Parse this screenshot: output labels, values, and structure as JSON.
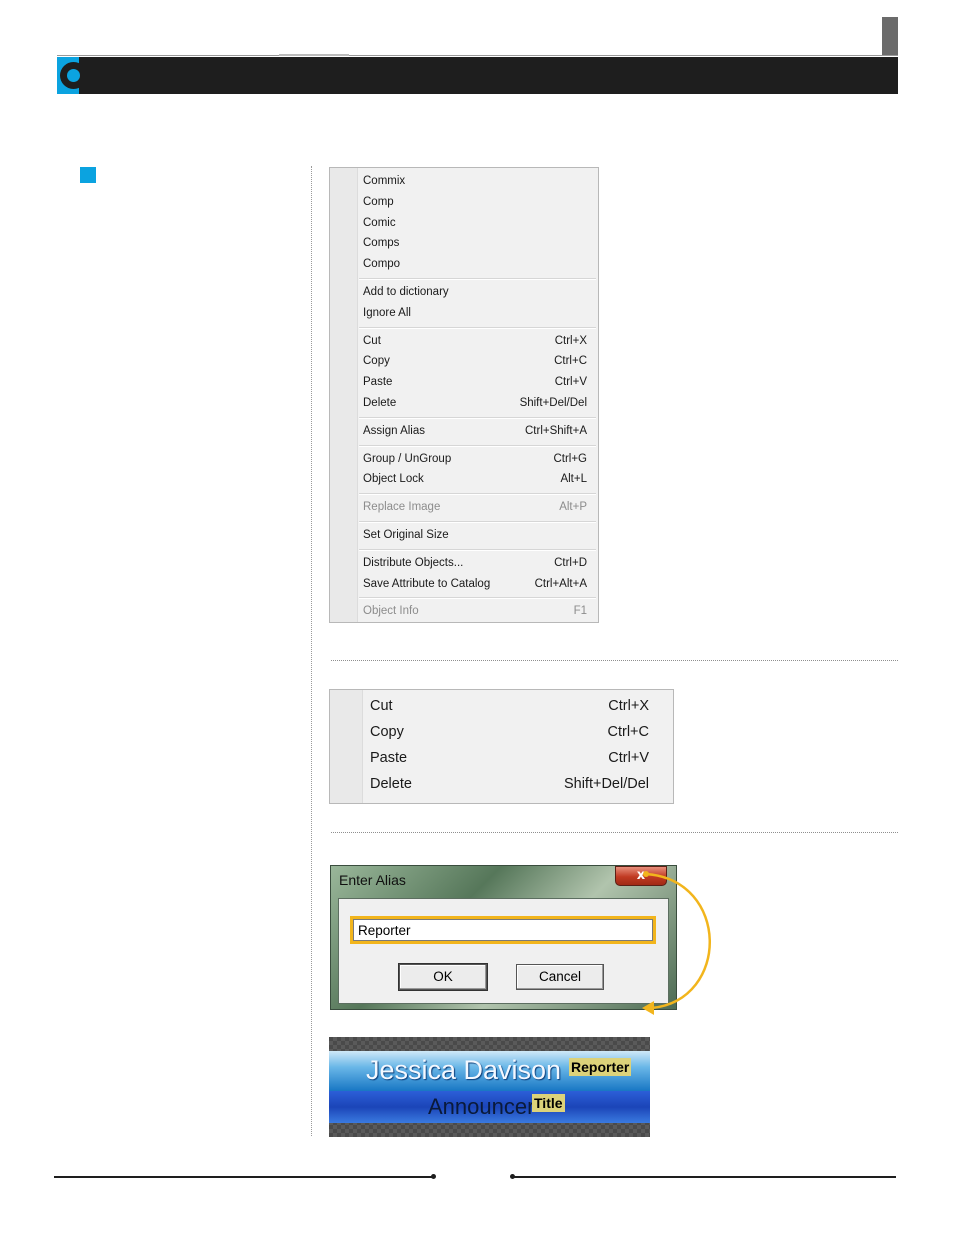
{
  "menu_full": {
    "groups": [
      [
        {
          "label": "Commix",
          "shortcut": "",
          "disabled": false
        },
        {
          "label": "Comp",
          "shortcut": "",
          "disabled": false
        },
        {
          "label": "Comic",
          "shortcut": "",
          "disabled": false
        },
        {
          "label": "Comps",
          "shortcut": "",
          "disabled": false
        },
        {
          "label": "Compo",
          "shortcut": "",
          "disabled": false
        }
      ],
      [
        {
          "label": "Add to dictionary",
          "shortcut": "",
          "disabled": false
        },
        {
          "label": "Ignore All",
          "shortcut": "",
          "disabled": false
        }
      ],
      [
        {
          "label": "Cut",
          "shortcut": "Ctrl+X",
          "disabled": false
        },
        {
          "label": "Copy",
          "shortcut": "Ctrl+C",
          "disabled": false
        },
        {
          "label": "Paste",
          "shortcut": "Ctrl+V",
          "disabled": false
        },
        {
          "label": "Delete",
          "shortcut": "Shift+Del/Del",
          "disabled": false
        }
      ],
      [
        {
          "label": "Assign Alias",
          "shortcut": "Ctrl+Shift+A",
          "disabled": false
        }
      ],
      [
        {
          "label": "Group / UnGroup",
          "shortcut": "Ctrl+G",
          "disabled": false
        },
        {
          "label": "Object Lock",
          "shortcut": "Alt+L",
          "disabled": false
        }
      ],
      [
        {
          "label": "Replace Image",
          "shortcut": "Alt+P",
          "disabled": true
        }
      ],
      [
        {
          "label": "Set Original Size",
          "shortcut": "",
          "disabled": false
        }
      ],
      [
        {
          "label": "Distribute Objects...",
          "shortcut": "Ctrl+D",
          "disabled": false
        },
        {
          "label": "Save Attribute to Catalog",
          "shortcut": "Ctrl+Alt+A",
          "disabled": false
        }
      ],
      [
        {
          "label": "Object Info",
          "shortcut": "F1",
          "disabled": true
        }
      ]
    ]
  },
  "menu_edit": {
    "items": [
      {
        "label": "Cut",
        "shortcut": "Ctrl+X"
      },
      {
        "label": "Copy",
        "shortcut": "Ctrl+C"
      },
      {
        "label": "Paste",
        "shortcut": "Ctrl+V"
      },
      {
        "label": "Delete",
        "shortcut": "Shift+Del/Del"
      }
    ]
  },
  "dialog": {
    "title": "Enter Alias",
    "close_glyph": "x",
    "input_value": "Reporter",
    "ok_label": "OK",
    "cancel_label": "Cancel"
  },
  "preview": {
    "name": "Jessica Davison",
    "title_text": "Announcer",
    "alias_tag": "Reporter",
    "title_tag": "Title"
  },
  "colors": {
    "accent": "#0ba3e0",
    "header_bar": "#1e1e1e",
    "highlight": "#f2b51c"
  }
}
